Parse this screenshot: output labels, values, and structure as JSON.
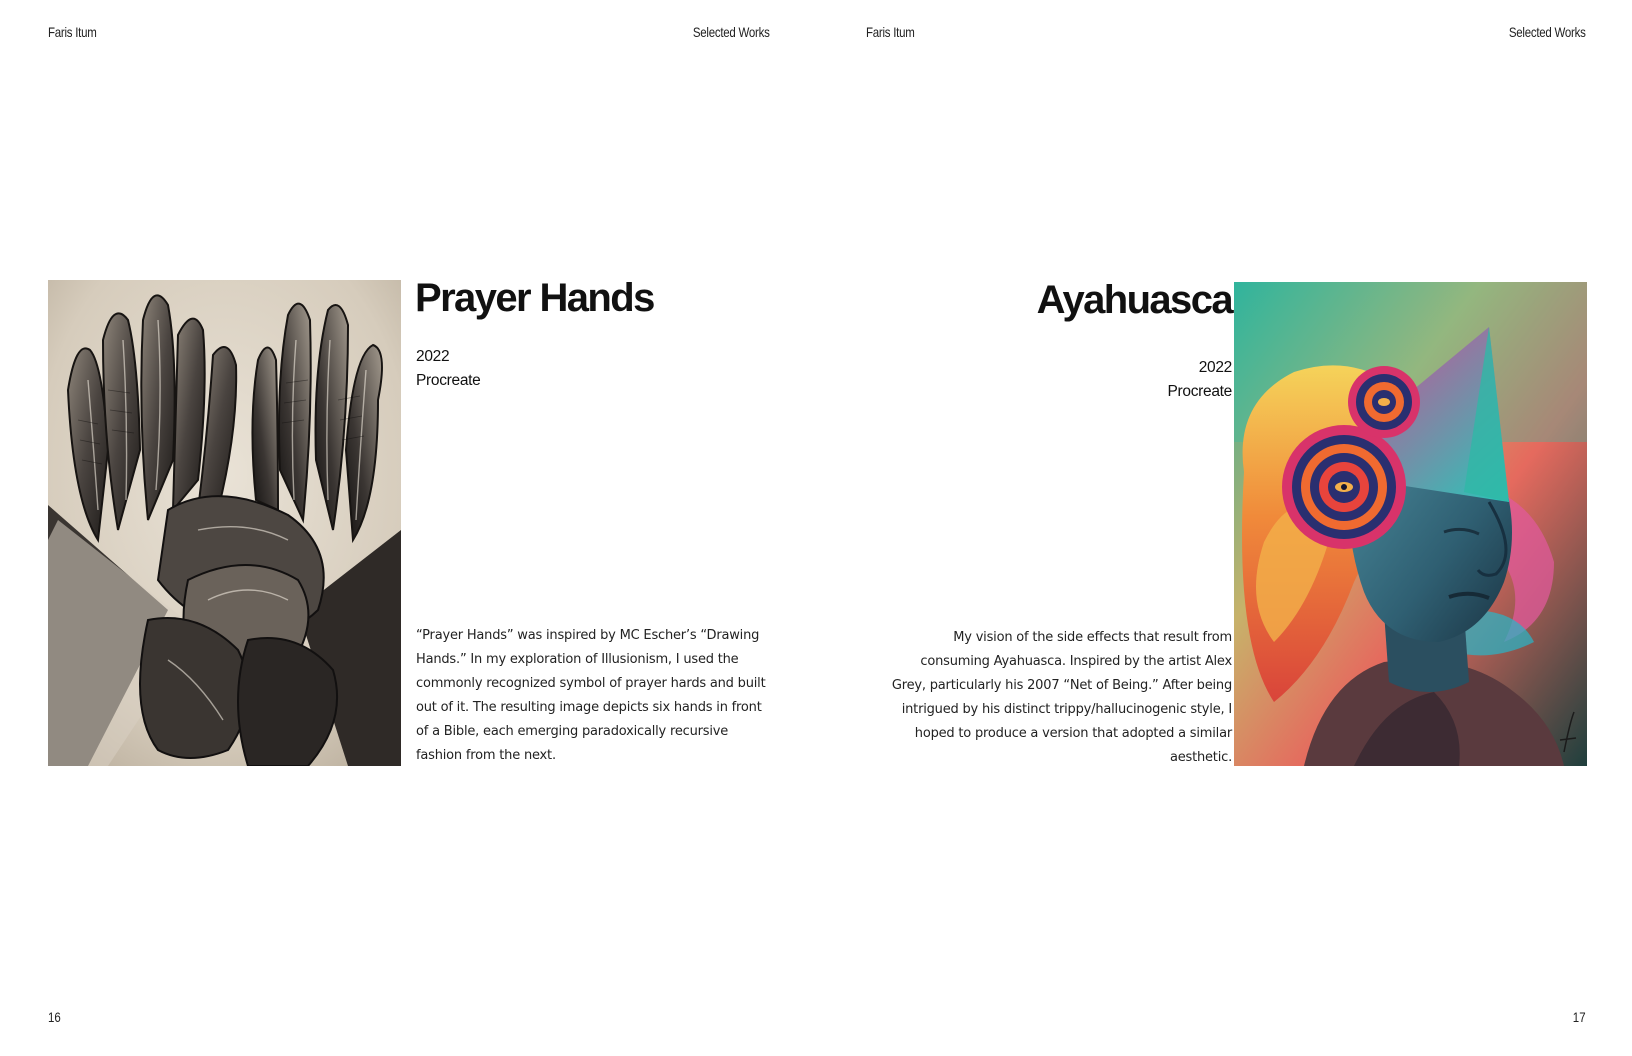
{
  "spread": {
    "left": {
      "header_author": "Faris Itum",
      "header_section": "Selected Works",
      "page_number": "16",
      "artwork": {
        "title": "Prayer Hands",
        "year": "2022",
        "medium": "Procreate",
        "description": "“Prayer Hands” was inspired by MC Escher’s “Drawing Hands.” In my exploration of Illusionism, I used the commonly recognized symbol of prayer hards and built out of it. The resulting image depicts six hands in front of a Bible, each emerging paradoxically recursive fashion from the next."
      }
    },
    "right": {
      "header_author": "Faris Itum",
      "header_section": "Selected Works",
      "page_number": "17",
      "artwork": {
        "title": "Ayahuasca",
        "year": "2022",
        "medium": "Procreate",
        "description": "My vision of the side effects that result from consuming Ayahuasca. Inspired by the artist Alex Grey, particularly his 2007 “Net of Being.” After being intrigued by his distinct trippy/hallucinogenic style, I hoped to produce a version that adopted a similar aesthetic."
      }
    }
  }
}
